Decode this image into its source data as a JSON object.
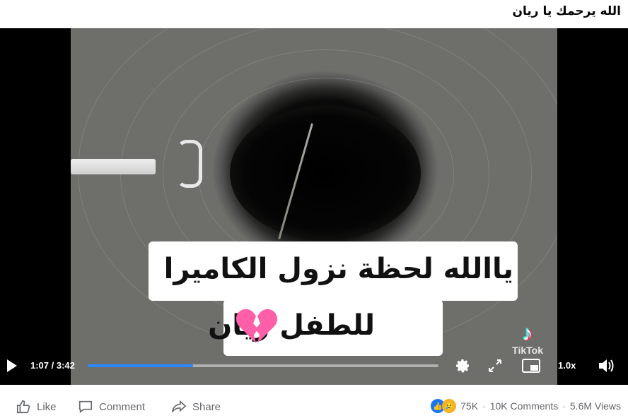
{
  "post": {
    "caption": "الله يرحمك يا ريان"
  },
  "video": {
    "overlay_line1": "ياالله لحظة نزول الكاميرا",
    "overlay_line2": "للطفل ريان",
    "watermark": "TikTok",
    "time": "1:07 / 3:42",
    "progress": 0.3,
    "speed": "1.0x",
    "icons": {
      "play": "play-icon",
      "settings": "gear-icon",
      "expand": "expand-icon",
      "pip": "pip-icon",
      "volume": "volume-icon",
      "heart": "broken-heart-emoji"
    }
  },
  "actions": {
    "like": "Like",
    "comment": "Comment",
    "share": "Share"
  },
  "stats": {
    "reactions": "75K",
    "comments": "10K Comments",
    "views": "5.6M Views",
    "separator": "·"
  },
  "colors": {
    "accent": "#2d88ff",
    "muted_text": "#65676b"
  }
}
